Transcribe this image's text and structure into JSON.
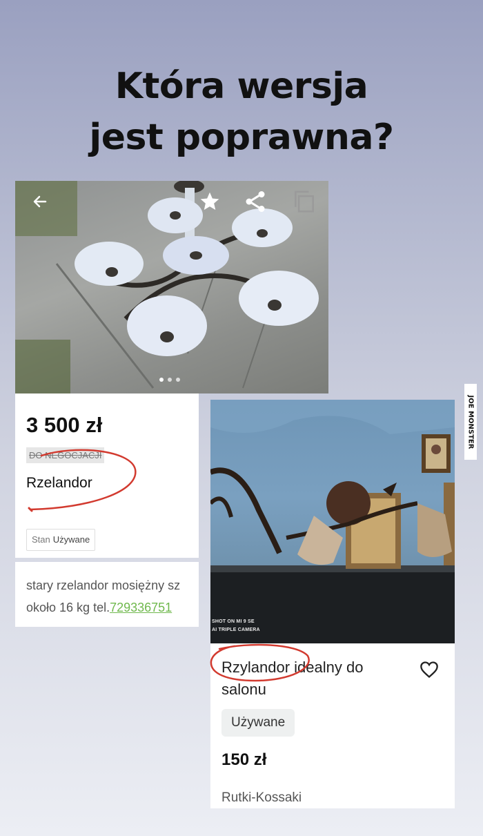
{
  "headline": {
    "line1": "Która wersja",
    "line2": "jest poprawna?"
  },
  "listing_left": {
    "price": "3 500 zł",
    "negotiation_label": "DO NEGOCJACJI",
    "title": "Rzelandor",
    "condition_key": "Stan",
    "condition_value": "Używane",
    "description_line1": "stary rzelandor mosiężny sz",
    "description_line2_prefix": "około 16 kg tel.",
    "phone": "729336751",
    "icons": [
      "back-arrow-icon",
      "star-icon",
      "share-icon",
      "copy-icon"
    ],
    "image_pager": "3 dots"
  },
  "listing_right": {
    "title": "Rzylandor idealny do salonu",
    "condition": "Używane",
    "price": "150 zł",
    "location": "Rutki-Kossaki",
    "watermark_line1": "SHOT ON MI 9 SE",
    "watermark_line2": "AI TRIPLE CAMERA",
    "icons": [
      "heart-icon"
    ]
  },
  "side_logo": "JOE MONSTER",
  "colors": {
    "circle_annotation": "#d23a2f",
    "link": "#6fb84c"
  }
}
